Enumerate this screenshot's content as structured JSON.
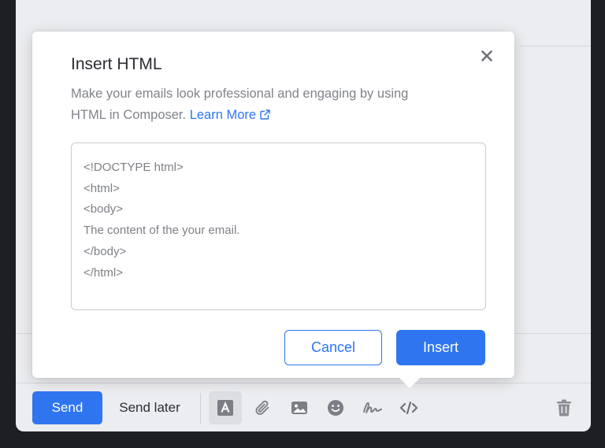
{
  "dialog": {
    "title": "Insert HTML",
    "description": "Make your emails look professional and engaging by using HTML in Composer.",
    "learn_more_label": "Learn More",
    "html_value": "<!DOCTYPE html>\n<html>\n<body>\nThe content of the your email.\n</body>\n</html>",
    "cancel_label": "Cancel",
    "insert_label": "Insert"
  },
  "toolbar": {
    "send_label": "Send",
    "send_later_label": "Send later",
    "tools": [
      {
        "icon": "text-format-icon",
        "active": true
      },
      {
        "icon": "attachment-icon",
        "active": false
      },
      {
        "icon": "image-icon",
        "active": false
      },
      {
        "icon": "emoji-icon",
        "active": false
      },
      {
        "icon": "signature-icon",
        "active": false
      },
      {
        "icon": "code-icon",
        "active": false
      }
    ],
    "trash_icon": "trash-icon"
  },
  "colors": {
    "accent": "#2f75f0",
    "background": "#1e1f23",
    "composer": "#ecedf0"
  }
}
